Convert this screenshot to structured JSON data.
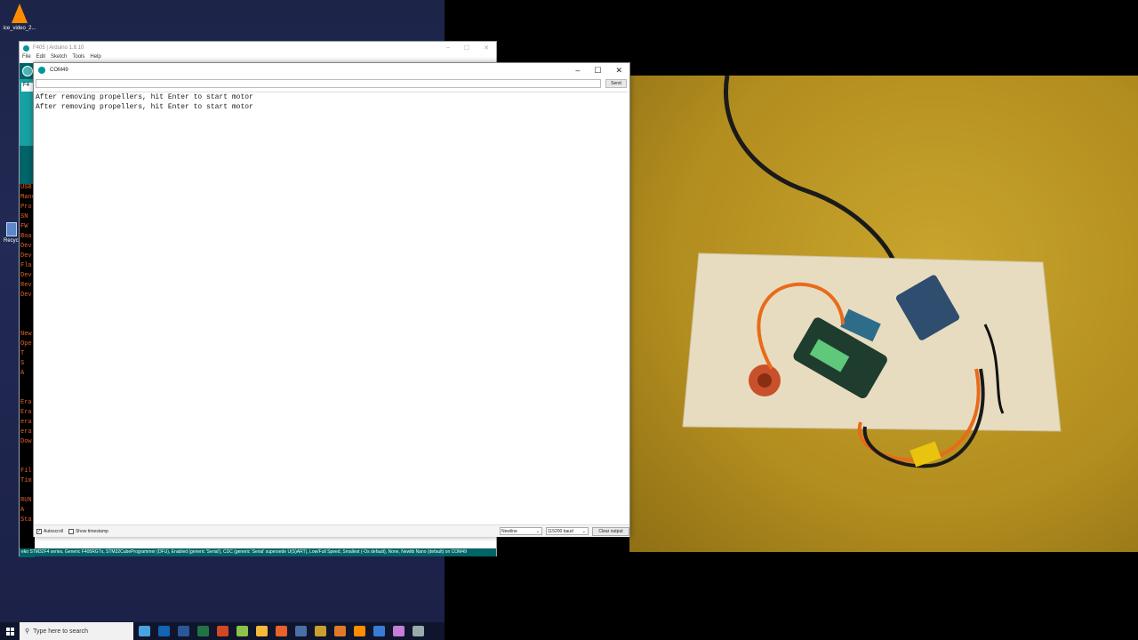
{
  "desktop": {
    "icon_label": "ice_video_2...",
    "recycle_label": "Recycl"
  },
  "ide": {
    "title": "F405 | Arduino 1.8.10",
    "menu": [
      "File",
      "Edit",
      "Sketch",
      "Tools",
      "Help"
    ],
    "tab": "F4",
    "console_lines": [
      "USB",
      "Manu",
      "Pro",
      "SN",
      "FW",
      "Boa",
      "Dev",
      "Dev",
      "Fla",
      "Dev",
      "Rev",
      "Dev",
      "",
      "",
      "",
      "New",
      "Ope",
      " T",
      "  S",
      "  A",
      "",
      "",
      "Era",
      "Era",
      "era",
      "era",
      "Dow",
      "",
      "",
      "Fil",
      "Tim",
      "",
      "RUN",
      "  A",
      "Sta"
    ],
    "status": "eko STM32F4 series, Generic F405RGTx, STM32CubeProgrammer (DFU), Enabled (generic 'Serial'), CDC (generic 'Serial' supersede U(S)ART), Low/Full Speed, Smallest (-Os default), None, Newlib Nano (default) on COM49"
  },
  "serial": {
    "title": "COM49",
    "input_value": "",
    "send_label": "Send",
    "lines": [
      "After removing propellers, hit Enter to start motor",
      "After removing propellers, hit Enter to start motor"
    ],
    "autoscroll_label": "Autoscroll",
    "autoscroll_checked": true,
    "timestamp_label": "Show timestamp",
    "timestamp_checked": false,
    "line_ending": "Newline",
    "baud": "115200 baud",
    "clear_label": "Clear output"
  },
  "taskbar": {
    "search_placeholder": "Type here to search",
    "icons": [
      {
        "name": "paint-icon",
        "color": "#4aa3df"
      },
      {
        "name": "outlook-icon",
        "color": "#1464b4"
      },
      {
        "name": "word-icon",
        "color": "#2b579a"
      },
      {
        "name": "excel-icon",
        "color": "#217346"
      },
      {
        "name": "powerpoint-icon",
        "color": "#d24726"
      },
      {
        "name": "chat-icon",
        "color": "#8bc34a"
      },
      {
        "name": "tray-app-icon",
        "color": "#f6b93b"
      },
      {
        "name": "orange-app-icon",
        "color": "#e8622a"
      },
      {
        "name": "app-icon",
        "color": "#4a6fa5"
      },
      {
        "name": "circle-app-icon",
        "color": "#c9a030"
      },
      {
        "name": "editor-icon",
        "color": "#e07a2a"
      },
      {
        "name": "vlc-icon",
        "color": "#ff8c00"
      },
      {
        "name": "cube-icon",
        "color": "#3a7bd5"
      },
      {
        "name": "vs-icon",
        "color": "#c47dd8"
      },
      {
        "name": "unknown-icon",
        "color": "#9aa"
      }
    ]
  }
}
